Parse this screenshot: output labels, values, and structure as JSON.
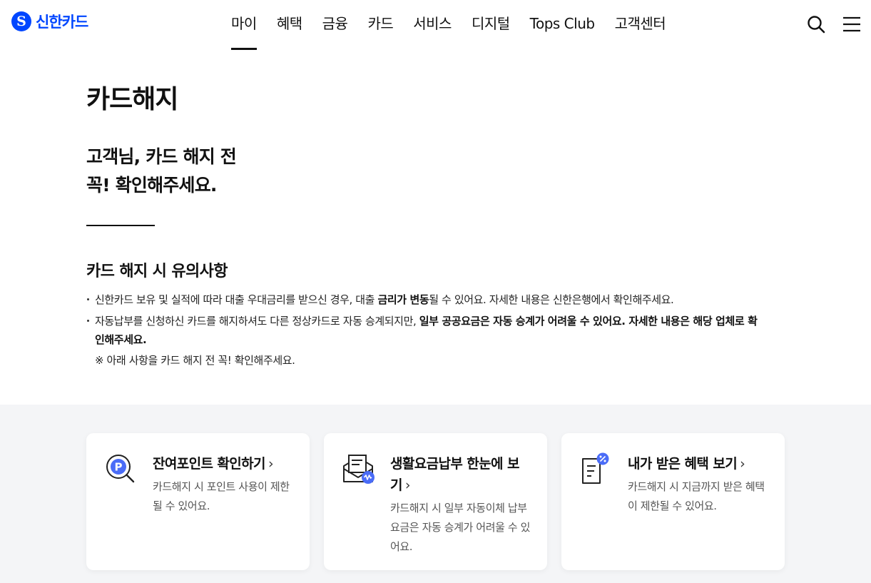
{
  "header": {
    "logo_text": "신한카드",
    "logo_mark": "S",
    "nav": [
      {
        "label": "마이",
        "active": true
      },
      {
        "label": "혜택"
      },
      {
        "label": "금융"
      },
      {
        "label": "카드"
      },
      {
        "label": "서비스"
      },
      {
        "label": "디지털"
      },
      {
        "label": "Tops Club"
      },
      {
        "label": "고객센터"
      }
    ],
    "icons": [
      "search-icon",
      "menu-icon"
    ]
  },
  "page": {
    "title": "카드해지",
    "subtitle_line1": "고객님, 카드 해지 전",
    "subtitle_line2": "꼭! 확인해주세요."
  },
  "notice": {
    "title": "카드 해지 시 유의사항",
    "item1_pre": "신한카드 보유 및 실적에 따라 대출 우대금리를 받으신 경우, 대출 ",
    "item1_bold": "금리가 변동",
    "item1_post": "될 수 있어요. 자세한 내용은 신한은행에서 확인해주세요.",
    "item2_pre": "자동납부를 신청하신 카드를 해지하셔도 다른 정상카드로 자동 승계되지만, ",
    "item2_bold": "일부 공공요금은 자동 승계가 어려울 수 있어요. 자세한 내용은 해당 업체로 확인해주세요.",
    "note": "※ 아래 사항을 카드 해지 전 꼭! 확인해주세요."
  },
  "cards": [
    {
      "title": "잔여포인트 확인하기",
      "chevron": "›",
      "desc": "카드해지 시 포인트 사용이 제한 될 수 있어요.",
      "icon": "point-search-icon"
    },
    {
      "title": "생활요금납부 한눈에 보기",
      "chevron": "›",
      "desc": "카드해지 시 일부 자동이체 납부요금은 자동 승계가 어려울 수 있어요.",
      "icon": "bill-envelope-icon"
    },
    {
      "title": "내가 받은 혜택 보기",
      "chevron": "›",
      "desc": "카드해지 시 지금까지 받은 혜택이 제한될 수 있어요.",
      "icon": "benefit-document-icon"
    }
  ],
  "colors": {
    "brand": "#0046ff",
    "section_bg": "#f4f5f7",
    "text": "#111111"
  }
}
